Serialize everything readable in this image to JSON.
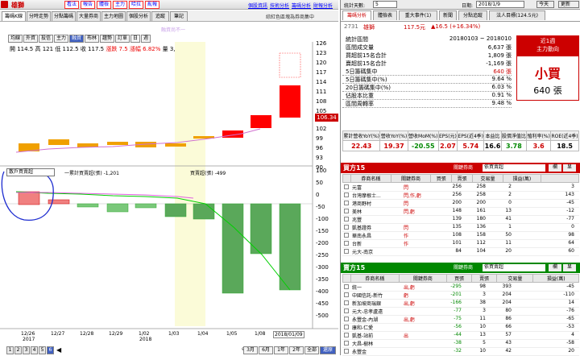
{
  "left": {
    "header": {
      "stock_name": "雄獅",
      "menu": [
        "看法",
        "報告",
        "體檢",
        "主力",
        "哈拉",
        "亂報"
      ],
      "links": [
        "個股資訊",
        "技術分析",
        "籌碼分析",
        "財報分析"
      ]
    },
    "tabs": [
      "籌碼K線",
      "分時走勢",
      "分點籌碼",
      "大量券商",
      "主力地圖",
      "個股分析",
      "追蹤",
      "筆記"
    ],
    "display_text": "綜紅色區塊為券商集中",
    "filter_buttons": [
      "均線",
      "外資",
      "投信",
      "主力",
      "融資",
      "布林",
      "趨勢",
      "訂單",
      "日",
      "週"
    ],
    "selected_filter": "融資",
    "price_info": {
      "open": "開 114.5",
      "high": "高 121",
      "low": "低 112.5",
      "close": "收 117.5",
      "change": "漲跌 7.5",
      "pct": "漲幅 6.82%",
      "vol": "量 3,989"
    },
    "upper_annot": "融資尚不一",
    "price_axis": [
      "126",
      "123",
      "120",
      "117",
      "114",
      "111",
      "108",
      "105",
      "102",
      "99",
      "96",
      "93",
      "90"
    ],
    "last_price_label": "106.34",
    "lower_select": "散戶買賣超",
    "lower_legend_1": "一累計買賣超(張) -1,201",
    "lower_legend_2": "買賣超(張) -499",
    "lower_axis": [
      "100",
      "50",
      "0",
      "-50",
      "-100",
      "-150",
      "-200",
      "-250",
      "-300",
      "-350",
      "-400",
      "-450",
      "-500"
    ],
    "dates": [
      "12/26",
      "12/27",
      "12/28",
      "12/29",
      "1/02",
      "1/03",
      "1/04",
      "1/05",
      "1/08",
      "2018/01/09"
    ],
    "years": [
      "2017",
      "2018"
    ],
    "pages": [
      "1",
      "2",
      "3",
      "4",
      "5",
      "6"
    ],
    "nav_buttons": [
      "3月",
      "6月",
      "1年",
      "2年",
      "全部",
      "還原"
    ]
  },
  "right": {
    "top": {
      "account_label": "統計天數:",
      "days": "5",
      "date_label": "日期:",
      "date": "2018/1/9",
      "today": "今天",
      "update": "更新"
    },
    "tabs": [
      "籌碼分析",
      "體檢表",
      "重大事件(1)",
      "新聞",
      "分點追蹤",
      "法人目標(124.5元)"
    ],
    "code": "2731",
    "name": "雄獅",
    "price": "117.5元",
    "chg": "▲16.5 (+16.34%)",
    "stats": [
      {
        "label": "統計區間",
        "value": "20180103 ~ 2018010"
      },
      {
        "label": "區間成交量",
        "value": "6,637 張"
      },
      {
        "label": "買超前15名合計",
        "value": "1,809 張"
      },
      {
        "label": "賣超前15名合計",
        "value": "-1,169 張"
      },
      {
        "label": "5日籌碼集中",
        "value": "640 張"
      },
      {
        "label": "5日籌碼集中(%)",
        "value": "9.64 %"
      },
      {
        "label": "20日籌碼集中(%)",
        "value": "6.03 %"
      },
      {
        "label": "佔股本比重",
        "value": "0.91 %"
      },
      {
        "label": "區間周轉率",
        "value": "9.48 %"
      }
    ],
    "trend": {
      "title": "近1週",
      "sub": "主力動向",
      "big": "小買",
      "amount": "640 張"
    },
    "kpi_headers": [
      "累計營收YoY(%)",
      "營收YoY(%)",
      "營收MoM(%)",
      "EPS(元)",
      "EPS(近4季)",
      "本益比",
      "股價淨值比",
      "殖利率(%)",
      "ROE(近4季)"
    ],
    "kpi_values": [
      "22.43",
      "19.37",
      "-20.55",
      "2.07",
      "5.74",
      "16.6",
      "3.78",
      "3.6",
      "18.5"
    ],
    "buy": {
      "title": "買方15",
      "sort_label": "關鍵券商",
      "sort_value": "依買賣超",
      "btns": [
        "欄",
        "显"
      ],
      "headers": [
        "券商名稱",
        "關鍵券商",
        "買張",
        "賣張",
        "交易量",
        "損益(萬)"
      ],
      "rows": [
        [
          "元富",
          "閃",
          "256",
          "258",
          "2",
          "260",
          "3"
        ],
        [
          "台灣摩根士...",
          "閃,作,虧",
          "256",
          "258",
          "2",
          "260",
          "143"
        ],
        [
          "港商野村",
          "閃",
          "200",
          "200",
          "0",
          "200",
          "-45"
        ],
        [
          "美林",
          "閃,虧",
          "148",
          "161",
          "13",
          "174",
          "-12"
        ],
        [
          "兆豐",
          "",
          "139",
          "180",
          "41",
          "221",
          "-77"
        ],
        [
          "凱基證券",
          "閃",
          "135",
          "136",
          "1",
          "137",
          "0"
        ],
        [
          "華南永昌",
          "作",
          "108",
          "158",
          "50",
          "208",
          "98"
        ],
        [
          "台新",
          "作",
          "101",
          "112",
          "11",
          "123",
          "64"
        ],
        [
          "元大-南京",
          "",
          "84",
          "104",
          "20",
          "124",
          "60"
        ]
      ]
    },
    "sell": {
      "title": "賣方15",
      "sort_label": "關鍵券商",
      "sort_value": "依買賣超",
      "btns": [
        "欄",
        "显"
      ],
      "headers": [
        "券商名稱",
        "關鍵券商",
        "買張",
        "賣張",
        "交易量",
        "損益(萬)"
      ],
      "rows": [
        [
          "統一",
          "出,虧",
          "-295",
          "98",
          "393",
          "491",
          "-45"
        ],
        [
          "中國信託-新竹",
          "虧",
          "-201",
          "3",
          "204",
          "207",
          "-110"
        ],
        [
          "新加坡商瑞銀",
          "出,虧",
          "-166",
          "38",
          "204",
          "242",
          "14"
        ],
        [
          "元大-忠孝盧遠",
          "",
          "-77",
          "3",
          "80",
          "83",
          "-76"
        ],
        [
          "永豐金-內湖",
          "出,虧",
          "-75",
          "11",
          "86",
          "97",
          "-65"
        ],
        [
          "康和-仁愛",
          "",
          "-56",
          "10",
          "66",
          "76",
          "-53"
        ],
        [
          "凱基-站前",
          "出",
          "-44",
          "13",
          "57",
          "70",
          "4"
        ],
        [
          "大昌-樹林",
          "",
          "-38",
          "5",
          "43",
          "48",
          "-58"
        ],
        [
          "永豐金",
          "",
          "-32",
          "10",
          "42",
          "52",
          "20"
        ]
      ]
    }
  }
}
